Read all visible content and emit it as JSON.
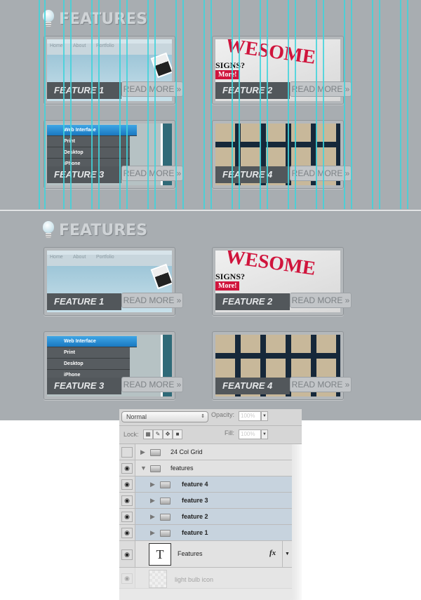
{
  "heading": "FEATURES",
  "features": [
    {
      "label": "FEATURE 1",
      "read_more": "READ MORE »",
      "nav": [
        "Home",
        "About",
        "Portfolio"
      ]
    },
    {
      "label": "FEATURE 2",
      "read_more": "READ MORE »",
      "headline": "WESOME",
      "sub": "SIGNS?",
      "more": "More!"
    },
    {
      "label": "FEATURE 3",
      "read_more": "READ MORE »",
      "menu": [
        "Web Interface",
        "Print",
        "Desktop",
        "iPhone"
      ]
    },
    {
      "label": "FEATURE 4",
      "read_more": "READ MORE »"
    }
  ],
  "grid_color": "#3fd4dc",
  "layers_panel": {
    "blend_mode": "Normal",
    "opacity_label": "Opacity:",
    "opacity": "100%",
    "lock_label": "Lock:",
    "fill_label": "Fill:",
    "fill": "100%",
    "fx": "fx",
    "text_thumb": "T",
    "layers": [
      {
        "name": "24 Col Grid",
        "visible": false
      },
      {
        "name": "features",
        "visible": true
      },
      {
        "name": "feature 4",
        "visible": true
      },
      {
        "name": "feature 3",
        "visible": true
      },
      {
        "name": "feature 2",
        "visible": true
      },
      {
        "name": "feature 1",
        "visible": true
      },
      {
        "name": "Features",
        "visible": true
      },
      {
        "name": "light bulb icon",
        "visible": true
      }
    ]
  }
}
